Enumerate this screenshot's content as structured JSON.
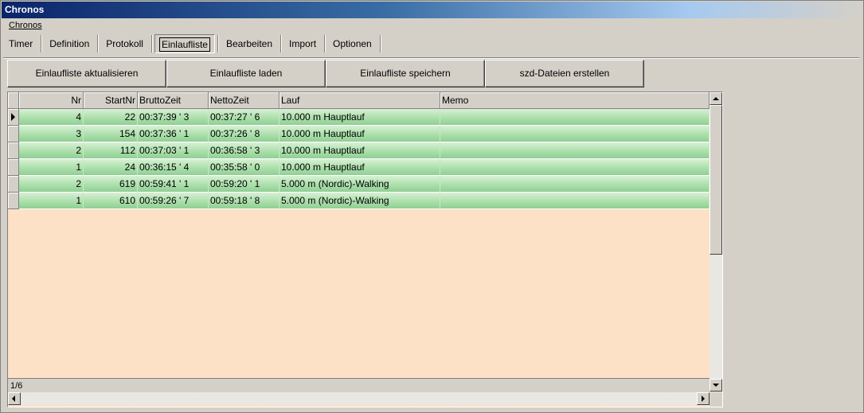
{
  "window": {
    "title": "Chronos"
  },
  "menu": {
    "items": [
      "Chronos"
    ]
  },
  "tabs": [
    {
      "label": "Timer"
    },
    {
      "label": "Definition"
    },
    {
      "label": "Protokoll"
    },
    {
      "label": "Einlaufliste",
      "active": true
    },
    {
      "label": "Bearbeiten"
    },
    {
      "label": "Import"
    },
    {
      "label": "Optionen"
    }
  ],
  "toolbar": {
    "refresh_label": "Einlaufliste aktualisieren",
    "load_label": "Einlaufliste laden",
    "save_label": "Einlaufliste speichern",
    "szd_label": "szd-Dateien erstellen"
  },
  "grid": {
    "columns": [
      "Nr",
      "StartNr",
      "BruttoZeit",
      "NettoZeit",
      "Lauf",
      "Memo"
    ],
    "rows": [
      {
        "nr": "4",
        "startnr": "22",
        "brutto": "00:37:39 ' 3",
        "netto": "00:37:27 ' 6",
        "lauf": "10.000 m Hauptlauf",
        "memo": ""
      },
      {
        "nr": "3",
        "startnr": "154",
        "brutto": "00:37:36 ' 1",
        "netto": "00:37:26 ' 8",
        "lauf": "10.000 m Hauptlauf",
        "memo": ""
      },
      {
        "nr": "2",
        "startnr": "112",
        "brutto": "00:37:03 ' 1",
        "netto": "00:36:58 ' 3",
        "lauf": "10.000 m Hauptlauf",
        "memo": ""
      },
      {
        "nr": "1",
        "startnr": "24",
        "brutto": "00:36:15 ' 4",
        "netto": "00:35:58 ' 0",
        "lauf": "10.000 m Hauptlauf",
        "memo": ""
      },
      {
        "nr": "2",
        "startnr": "619",
        "brutto": "00:59:41 ' 1",
        "netto": "00:59:20 ' 1",
        "lauf": "5.000 m (Nordic)-Walking",
        "memo": ""
      },
      {
        "nr": "1",
        "startnr": "610",
        "brutto": "00:59:26 ' 7",
        "netto": "00:59:18 ' 8",
        "lauf": "5.000 m (Nordic)-Walking",
        "memo": ""
      }
    ],
    "status": "1/6"
  },
  "colors": {
    "row_green": "#b3e3b2",
    "empty_area": "#fde1c6",
    "title_blue": "#0a246a"
  }
}
